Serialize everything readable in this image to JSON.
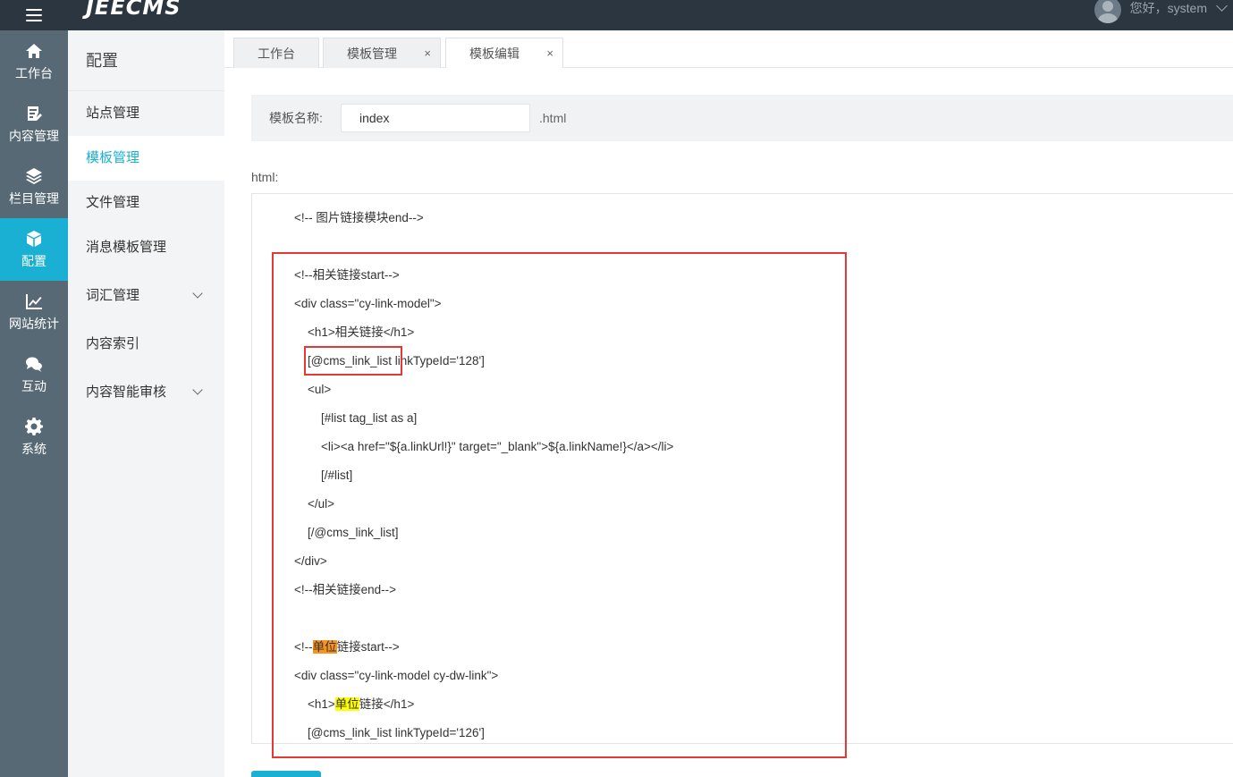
{
  "header": {
    "logo": "JEECMS",
    "greeting": "您好，system"
  },
  "leftnav": {
    "items": [
      {
        "label": "工作台",
        "icon": "home-icon"
      },
      {
        "label": "内容管理",
        "icon": "document-edit-icon"
      },
      {
        "label": "栏目管理",
        "icon": "layers-icon"
      },
      {
        "label": "配置",
        "icon": "cube-icon"
      },
      {
        "label": "网站统计",
        "icon": "line-chart-icon"
      },
      {
        "label": "互动",
        "icon": "chat-bubbles-icon"
      },
      {
        "label": "系统",
        "icon": "gear-icon"
      }
    ],
    "active_index": 3
  },
  "submenu": {
    "title": "配置",
    "items": [
      {
        "label": "站点管理"
      },
      {
        "label": "模板管理"
      },
      {
        "label": "文件管理"
      },
      {
        "label": "消息模板管理"
      },
      {
        "label": "词汇管理"
      },
      {
        "label": "内容索引"
      },
      {
        "label": "内容智能审核"
      }
    ]
  },
  "tabs": [
    {
      "label": "工作台"
    },
    {
      "label": "模板管理",
      "close": "×"
    },
    {
      "label": "模板编辑",
      "close": "×"
    }
  ],
  "form": {
    "name_label": "模板名称:",
    "name_value": "index",
    "name_suffix": ".html",
    "html_label": "html:"
  },
  "code": {
    "lines": [
      "<!-- 图片链接模块end-->",
      "",
      "<!--相关链接start-->",
      "<div class=\"cy-link-model\">",
      "    <h1>相关链接</h1>",
      "    [@cms_link_list linkTypeId='128']",
      "    <ul>",
      "        [#list tag_list as a]",
      "        <li><a href=\"${a.linkUrl!}\" target=\"_blank\">${a.linkName!}</a></li>",
      "        [/#list]",
      "    </ul>",
      "    [/@cms_link_list]",
      "</div>",
      "<!--相关链接end-->",
      "",
      "",
      "<div class=\"cy-link-model cy-dw-link\">",
      "",
      "    [@cms_link_list linkTypeId='126']"
    ],
    "line_15_prefix": "<!--",
    "line_15_highlight": "单位",
    "line_15_suffix": "链接start-->",
    "line_17_prefix": "    <h1>",
    "line_17_highlight": "单位",
    "line_17_suffix": "链接</h1>"
  },
  "highlight_colors": {
    "orange": "#f7931e",
    "yellow": "#ffff00",
    "annotation_box": "#e53935",
    "accent": "#19b0d3"
  }
}
